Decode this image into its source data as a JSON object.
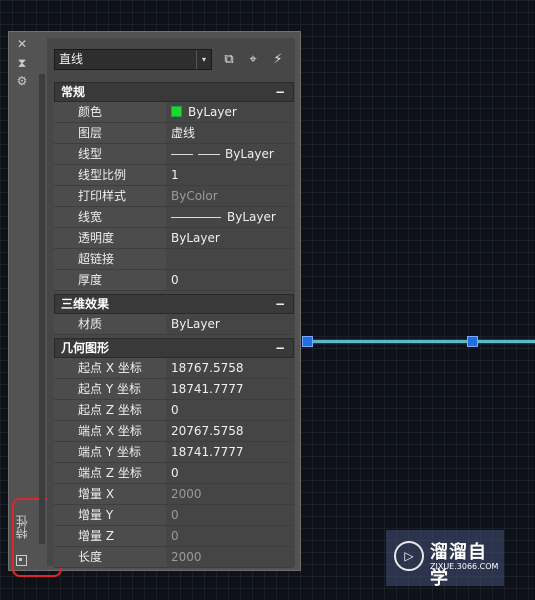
{
  "side_strip": {
    "close": "✕",
    "pin": "⧗",
    "settings": "⚙",
    "tab_label": "特性"
  },
  "toolbar": {
    "object_type": "直线",
    "arrow": "▾",
    "btn1": "⧉",
    "btn2": "⌖",
    "btn3": "⚡"
  },
  "sections": [
    {
      "title": "常规",
      "toggle": "−",
      "rows": [
        {
          "label": "颜色",
          "value": "ByLayer"
        },
        {
          "label": "图层",
          "value": "虚线"
        },
        {
          "label": "线型",
          "value": "ByLayer"
        },
        {
          "label": "线型比例",
          "value": "1"
        },
        {
          "label": "打印样式",
          "value": "ByColor"
        },
        {
          "label": "线宽",
          "value": "ByLayer"
        },
        {
          "label": "透明度",
          "value": "ByLayer"
        },
        {
          "label": "超链接",
          "value": ""
        },
        {
          "label": "厚度",
          "value": "0"
        }
      ]
    },
    {
      "title": "三维效果",
      "toggle": "−",
      "rows": [
        {
          "label": "材质",
          "value": "ByLayer"
        }
      ]
    },
    {
      "title": "几何图形",
      "toggle": "−",
      "rows": [
        {
          "label": "起点 X 坐标",
          "value": "18767.5758"
        },
        {
          "label": "起点 Y 坐标",
          "value": "18741.7777"
        },
        {
          "label": "起点 Z 坐标",
          "value": "0"
        },
        {
          "label": "端点 X 坐标",
          "value": "20767.5758"
        },
        {
          "label": "端点 Y 坐标",
          "value": "18741.7777"
        },
        {
          "label": "端点 Z 坐标",
          "value": "0"
        },
        {
          "label": "增量 X",
          "value": "2000"
        },
        {
          "label": "增量 Y",
          "value": "0"
        },
        {
          "label": "增量 Z",
          "value": "0"
        },
        {
          "label": "长度",
          "value": "2000"
        }
      ]
    }
  ],
  "colors": {
    "color_swatch": "#22d622",
    "line": "#5fb7c7",
    "grip": "#1f6fe0",
    "highlight": "#e0262c"
  },
  "watermark": {
    "logo": "▷",
    "name": "溜溜自学",
    "url": "ZIXUE.3066.COM"
  }
}
